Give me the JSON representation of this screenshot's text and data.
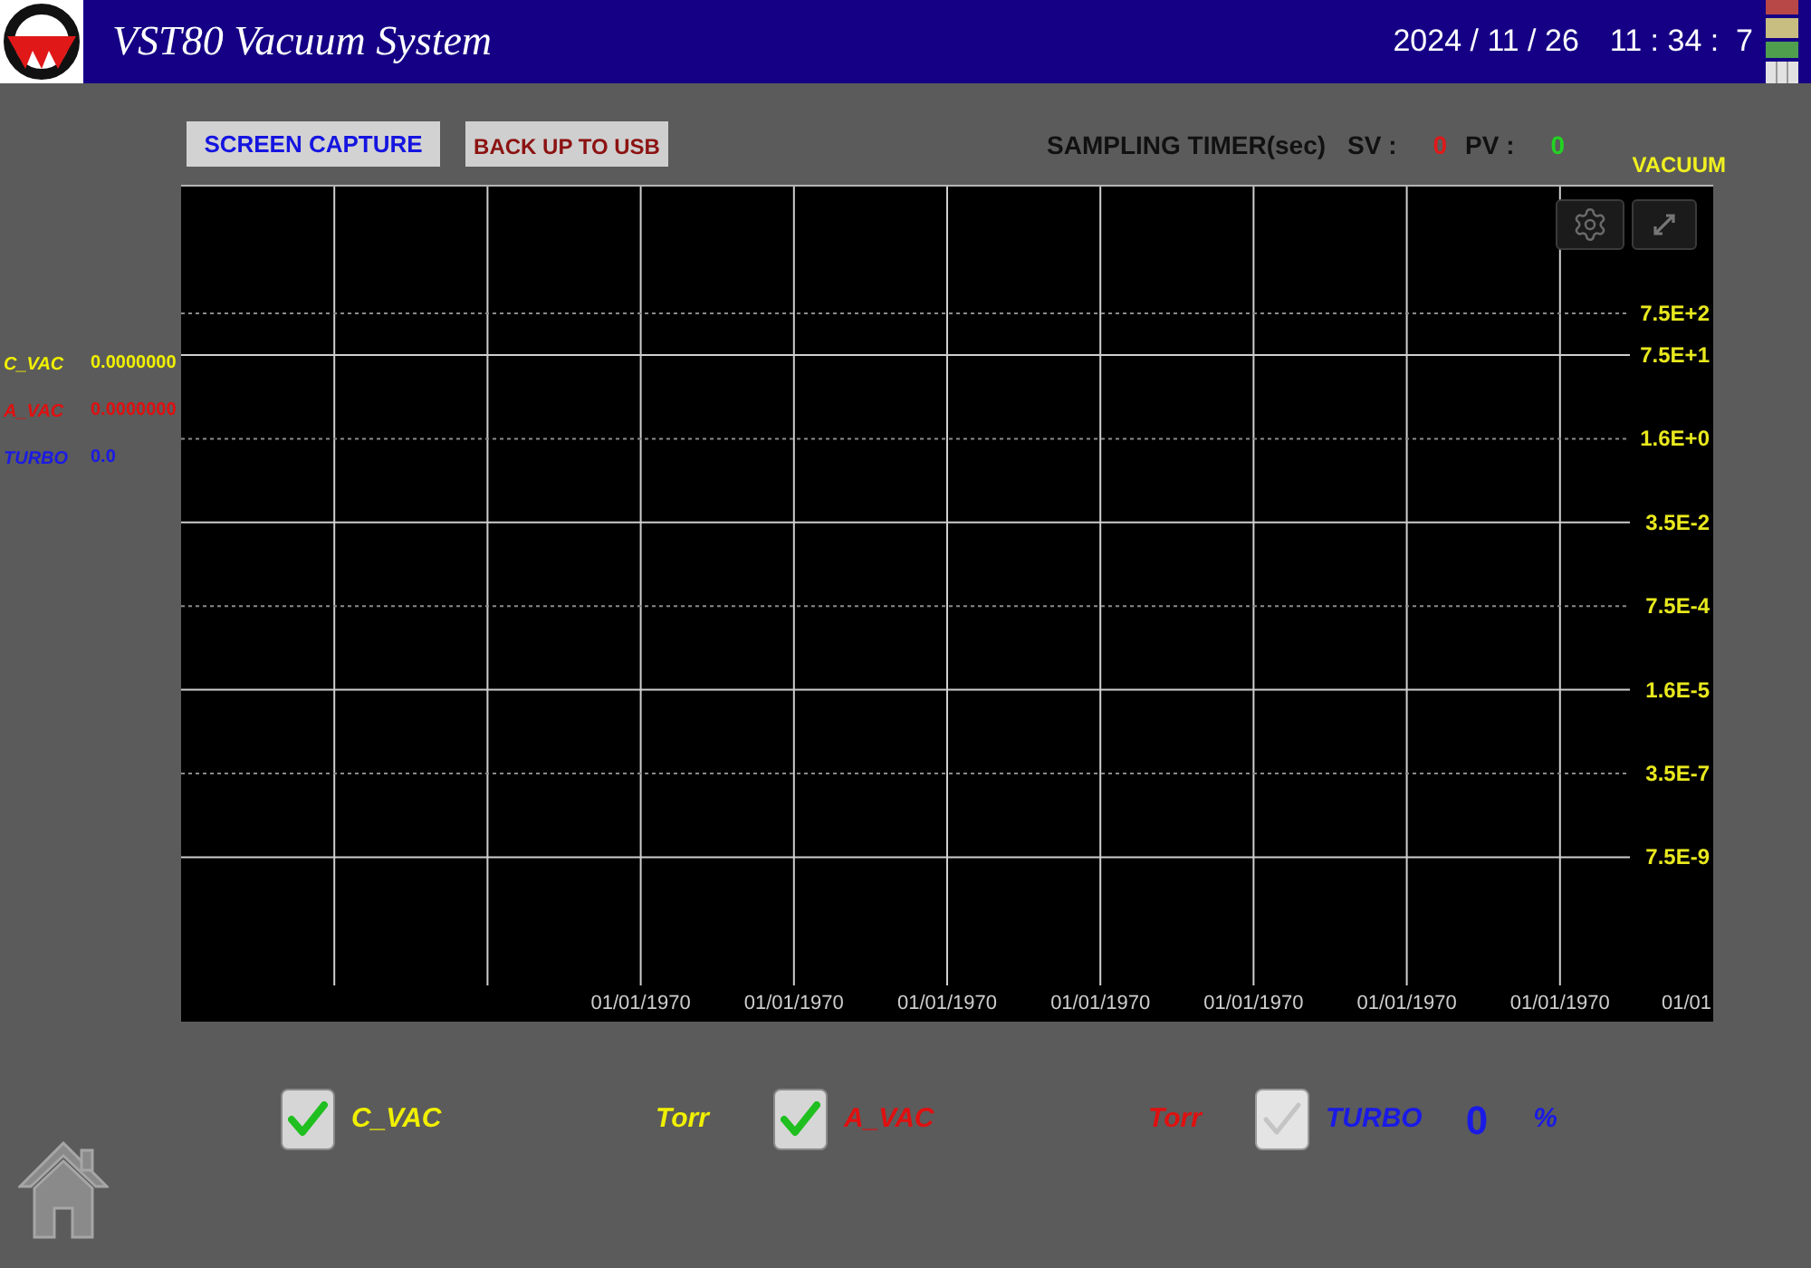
{
  "header": {
    "title": "VST80 Vacuum System",
    "date": "2024 / 11 / 26",
    "time": "11 : 34 :  7"
  },
  "toolbar": {
    "buttons": [
      {
        "label": "SCREEN CAPTURE",
        "kind": "capture"
      },
      {
        "label": "BACK UP TO USB",
        "kind": "backup"
      }
    ]
  },
  "sampling_timer": {
    "label": "SAMPLING TIMER(sec)",
    "sv_label": "SV :",
    "sv_value": "0",
    "pv_label": "PV :",
    "pv_value": "0"
  },
  "readings": [
    {
      "name": "C_VAC",
      "value": "0.0000000",
      "color": "#f0f000"
    },
    {
      "name": "A_VAC",
      "value": "0.0000000",
      "color": "#e01010"
    },
    {
      "name": "TURBO",
      "value": "0.0",
      "color": "#1a1ae6"
    }
  ],
  "chart": {
    "axis_title": "VACUUM",
    "y_axis_labels": [
      "7.5E+2",
      "7.5E+1",
      "1.6E+0",
      "3.5E-2",
      "7.5E-4",
      "1.6E-5",
      "3.5E-7",
      "7.5E-9"
    ],
    "x_axis_labels": [
      "01/01/1970",
      "01/01/1970",
      "01/01/1970",
      "01/01/1970",
      "01/01/1970",
      "01/01/1970",
      "01/01/1970",
      "01/01"
    ]
  },
  "channels": [
    {
      "name": "C_VAC",
      "checked": true,
      "unit": "Torr",
      "color": "#f0f000"
    },
    {
      "name": "A_VAC",
      "checked": true,
      "unit": "Torr",
      "color": "#e01010"
    },
    {
      "name": "TURBO",
      "checked": false,
      "value": "0",
      "unit": "%",
      "color": "#1a1ae6"
    }
  ]
}
